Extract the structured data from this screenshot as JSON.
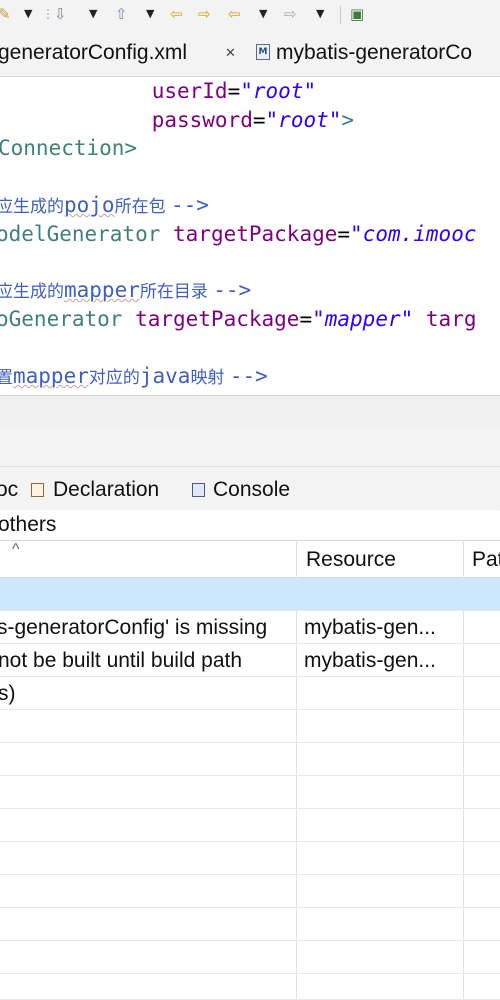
{
  "toolbar": {
    "icons": [
      "pin-icon",
      "dropdown-arrow-icon",
      "separator-grip-icon",
      "next-annotation-icon",
      "previous-annotation-icon",
      "back-icon",
      "forward-icon",
      "last-edit-location-icon",
      "open-perspective-icon"
    ]
  },
  "editor_tabs": [
    {
      "label": "generatorConfig.xml",
      "close": "✕"
    },
    {
      "label": "mybatis-generatorCo",
      "icon_glyph": "M"
    }
  ],
  "code": {
    "line1": {
      "attr": "userId",
      "eq": "=",
      "value": "\"root\""
    },
    "line2": {
      "attr": "password",
      "eq": "=",
      "value": "\"root\"",
      "close": ">"
    },
    "line3": {
      "text": "Connection>"
    },
    "line4": {
      "p1": "应生成的",
      "p2": "pojo",
      "p3": "所在包 ",
      "p4": "-->"
    },
    "line5": {
      "tag": "odelGenerator ",
      "attr": "targetPackage",
      "eq": "=",
      "value": "\"com.imooc"
    },
    "line6": {
      "p1": "应生成的",
      "p2": "mapper",
      "p3": "所在目录 ",
      "p4": "-->"
    },
    "line7": {
      "tag": "oGenerator ",
      "attr": "targetPackage",
      "eq": "=",
      "value": "\"mapper\"",
      "attr2": " targ"
    },
    "line8": {
      "p1": "置",
      "p2": "mapper",
      "p3": "对应的",
      "p4": "java",
      "p5": "映射 ",
      "p6": "-->"
    }
  },
  "view_tabs": [
    {
      "label": "oc"
    },
    {
      "label": "Declaration",
      "icon": "declaration-icon"
    },
    {
      "label": "Console",
      "icon": "console-icon"
    }
  ],
  "problems": {
    "summary": "others",
    "sort_glyph": "^",
    "columns": [
      "Resource",
      "Pat"
    ],
    "rows": [
      {
        "description": "",
        "resource": ""
      },
      {
        "description": "s-generatorConfig' is missing",
        "resource": "mybatis-gen..."
      },
      {
        "description": "not be built until build path",
        "resource": "mybatis-gen..."
      },
      {
        "description": "s)",
        "resource": ""
      },
      {
        "description": "",
        "resource": ""
      },
      {
        "description": "",
        "resource": ""
      },
      {
        "description": "",
        "resource": ""
      },
      {
        "description": "",
        "resource": ""
      },
      {
        "description": "",
        "resource": ""
      },
      {
        "description": "",
        "resource": ""
      },
      {
        "description": "",
        "resource": ""
      },
      {
        "description": "",
        "resource": ""
      },
      {
        "description": "",
        "resource": ""
      }
    ]
  },
  "colors": {
    "selection": "#cce8ff",
    "xml_attribute": "#7f007f",
    "xml_string": "#2a00ff",
    "xml_tag": "#3f7f7f",
    "xml_comment": "#3f5fbf"
  }
}
